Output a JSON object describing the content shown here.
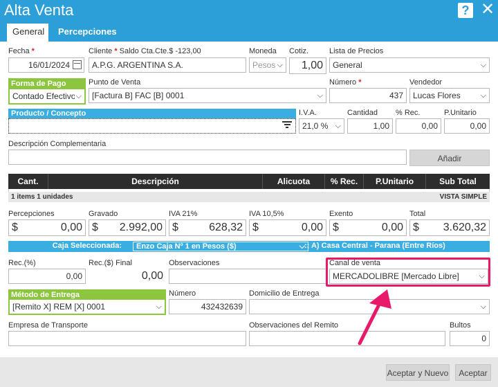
{
  "window": {
    "title": "Alta Venta",
    "help": "?",
    "close": "✕"
  },
  "tabs": [
    {
      "label": "General"
    },
    {
      "label": "Percepciones"
    }
  ],
  "fecha": {
    "label": "Fecha",
    "value": "16/01/2024"
  },
  "cliente": {
    "label": "Cliente",
    "saldo": "Saldo Cta.Cte.$ -123,00",
    "value": "A.P.G. ARGENTINA S.A."
  },
  "moneda": {
    "label": "Moneda",
    "value": "Pesos"
  },
  "cotiz": {
    "label": "Cotiz.",
    "value": "1,00"
  },
  "lista_precios": {
    "label": "Lista de Precios",
    "value": "General"
  },
  "forma_pago": {
    "label": "Forma de Pago",
    "value": "Contado Efectivo"
  },
  "punto_venta": {
    "label": "Punto de Venta",
    "value": "[Factura B] FAC [B] 0001"
  },
  "numero": {
    "label": "Número",
    "value": "437"
  },
  "vendedor": {
    "label": "Vendedor",
    "value": "Lucas Flores"
  },
  "producto": {
    "label": "Producto / Concepto",
    "value": ""
  },
  "iva": {
    "label": "I.V.A.",
    "value": "21,0 %"
  },
  "cantidad": {
    "label": "Cantidad",
    "value": "1,00"
  },
  "rec": {
    "label": "% Rec.",
    "value": "0,00"
  },
  "punitario": {
    "label": "P.Unitario",
    "value": "0,00"
  },
  "descripcion_comp": {
    "label": "Descripción Complementaria",
    "value": ""
  },
  "anadir": "Añadir",
  "table": {
    "headers": [
      "Cant.",
      "Descripción",
      "Alicuota",
      "% Rec.",
      "P.Unitario",
      "Sub Total"
    ],
    "footer_left": "1 items   1 unidades",
    "footer_right": "VISTA SIMPLE"
  },
  "totals": {
    "percepciones": {
      "label": "Percepciones",
      "value": "0,00"
    },
    "gravado": {
      "label": "Gravado",
      "value": "2.992,00"
    },
    "iva21": {
      "label": "IVA 21%",
      "value": "628,32"
    },
    "iva105": {
      "label": "IVA 10,5%",
      "value": "0,00"
    },
    "exento": {
      "label": "Exento",
      "value": "0,00"
    },
    "total": {
      "label": "Total",
      "value": "3.620,32"
    },
    "currency": "$"
  },
  "caja": {
    "label": "Caja Seleccionada:",
    "value": "Enzo Caja Nº 1 en Pesos ($)",
    "sucursal": ":: A) Casa Central - Parana (Entre Ríos)"
  },
  "rec_pct": {
    "label": "Rec.(%)",
    "value": "0,00"
  },
  "rec_final": {
    "label": "Rec.($) Final",
    "value": "0,00"
  },
  "observaciones": {
    "label": "Observaciones",
    "value": ""
  },
  "canal_venta": {
    "label": "Canal de venta",
    "value": "MERCADOLIBRE [Mercado Libre]"
  },
  "metodo_entrega": {
    "label": "Método de Entrega",
    "value": "[Remito X] REM [X] 0001"
  },
  "numero_remito": {
    "label": "Número",
    "value": "432432639"
  },
  "domicilio": {
    "label": "Domicilio de Entrega",
    "value": ""
  },
  "empresa_transporte": {
    "label": "Empresa de Transporte",
    "value": ""
  },
  "obs_remito": {
    "label": "Observaciones del Remito",
    "value": ""
  },
  "bultos": {
    "label": "Bultos",
    "value": "0"
  },
  "buttons": {
    "aceptar_nuevo": "Aceptar y Nuevo",
    "aceptar": "Aceptar"
  },
  "colors": {
    "primary": "#2c9fd9",
    "green": "#8cc63f",
    "highlight": "#e8196a"
  }
}
